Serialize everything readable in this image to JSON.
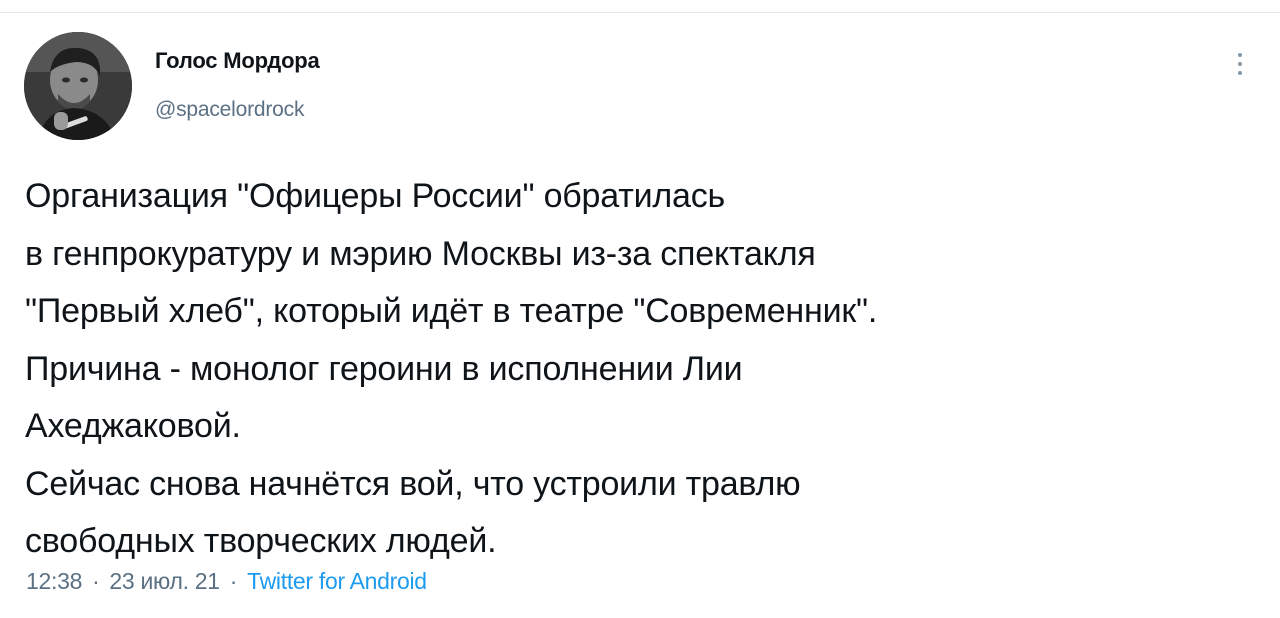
{
  "author": {
    "name": "Голос Мордора",
    "handle": "@spacelordrock",
    "avatar_icon": "profile-photo"
  },
  "menu": {
    "icon": "more-vertical-icon"
  },
  "tweet": {
    "lines": [
      "Организация \"Офицеры России\" обратилась",
      "в генпрокуратуру и мэрию Москвы из-за спектакля",
      "\"Первый хлеб\", который идёт в театре \"Современник\".",
      "Причина - монолог героини в исполнении Лии",
      "Ахеджаковой.",
      "Сейчас снова начнётся вой, что устроили травлю",
      "свободных творческих людей."
    ]
  },
  "meta": {
    "time": "12:38",
    "separator": "·",
    "date": "23 июл. 21",
    "source": "Twitter for Android"
  },
  "colors": {
    "text": "#0f1419",
    "secondary": "#5b7083",
    "link": "#1d9bf0",
    "divider": "#e3e6e8"
  }
}
